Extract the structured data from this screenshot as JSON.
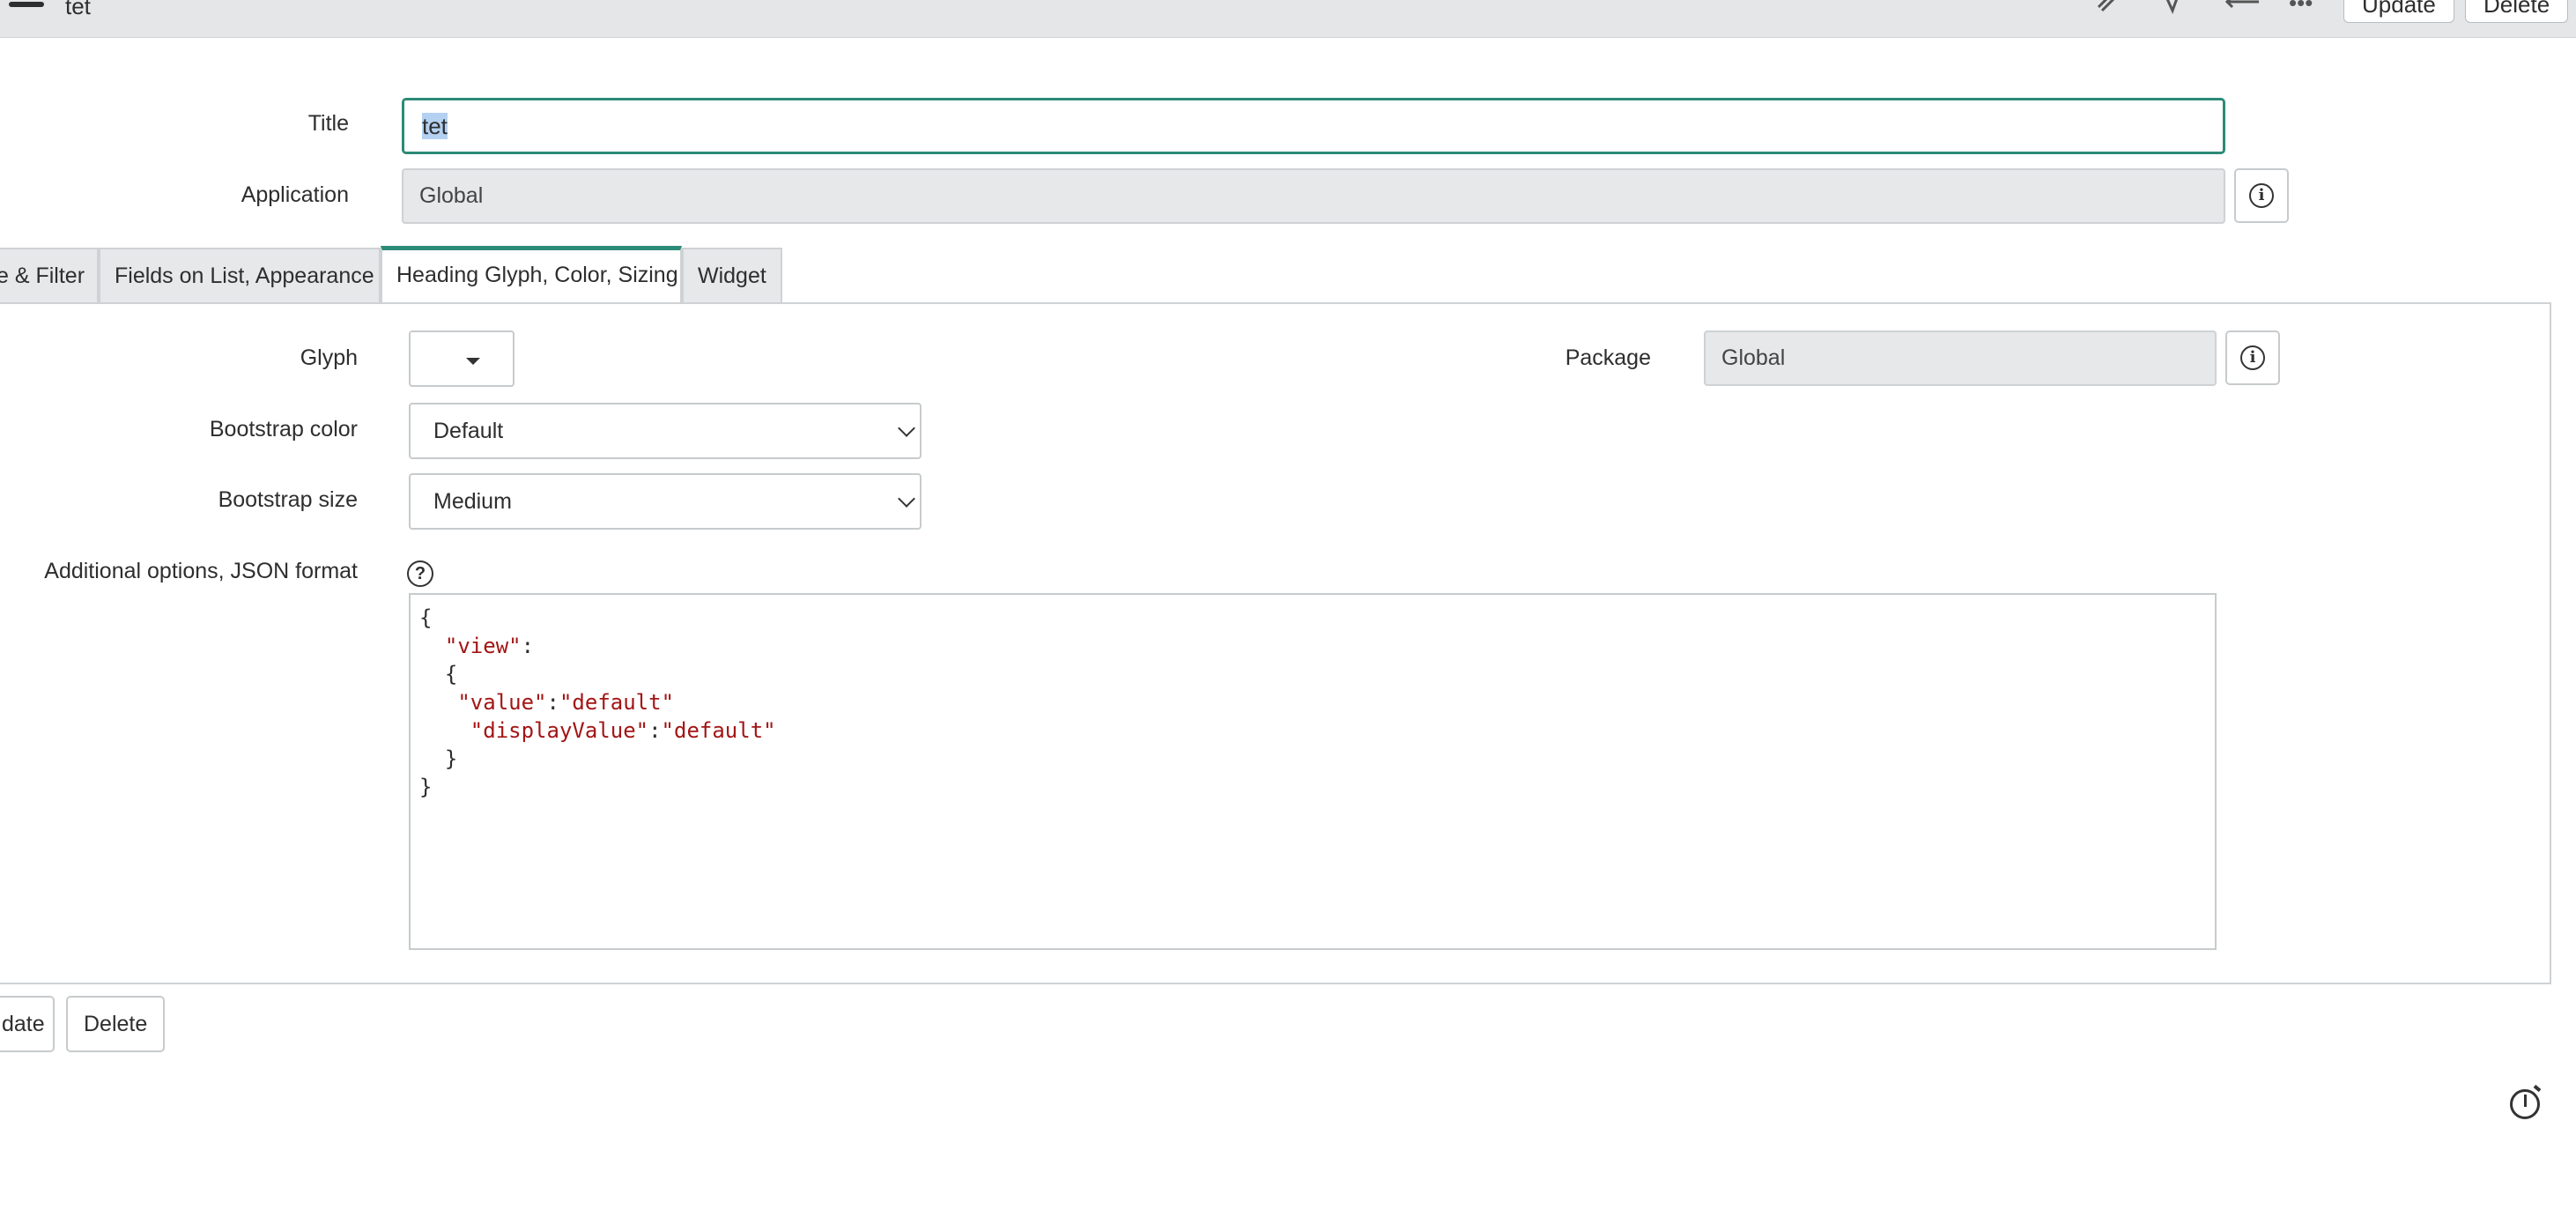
{
  "header": {
    "title": "tet",
    "more_label": "•••",
    "update_label": "Update",
    "delete_label": "Delete"
  },
  "form": {
    "title_label": "Title",
    "title_value": "tet",
    "application_label": "Application",
    "application_value": "Global"
  },
  "tabs": [
    {
      "label": "e & Filter"
    },
    {
      "label": "Fields on List, Appearance"
    },
    {
      "label": "Heading Glyph, Color, Sizing"
    },
    {
      "label": "Widget"
    }
  ],
  "active_tab": "Heading Glyph, Color, Sizing",
  "panel": {
    "glyph_label": "Glyph",
    "package_label": "Package",
    "package_value": "Global",
    "bootstrap_color_label": "Bootstrap color",
    "bootstrap_color_value": "Default",
    "bootstrap_size_label": "Bootstrap size",
    "bootstrap_size_value": "Medium",
    "json_label": "Additional options, JSON format",
    "json_lines": {
      "l1": "{",
      "l2_key": "\"view\"",
      "l2_rest": ":",
      "l3": "{",
      "l4_key": "\"value\"",
      "l4_sep": ":",
      "l4_val": "\"default\"",
      "l5_key": "\"displayValue\"",
      "l5_sep": ":",
      "l5_val": "\"default\"",
      "l6": "}",
      "l7": "}"
    }
  },
  "footer": {
    "update_label": "date",
    "delete_label": "Delete"
  },
  "colors": {
    "accent": "#2c8a78",
    "readonly_bg": "#e6e8e9",
    "json_string": "#a31515"
  }
}
